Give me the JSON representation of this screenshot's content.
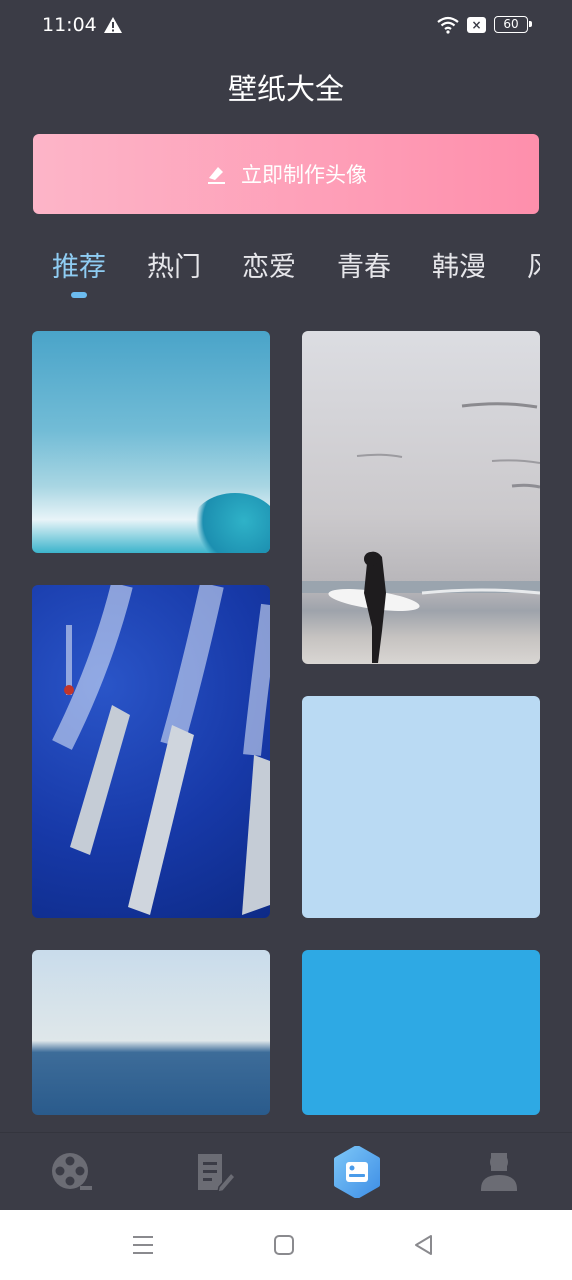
{
  "status_bar": {
    "time": "11:04",
    "battery": "60"
  },
  "header": {
    "title": "壁纸大全"
  },
  "cta": {
    "label": "立即制作头像",
    "icon": "edit-icon"
  },
  "tabs": [
    {
      "label": "推荐",
      "active": true
    },
    {
      "label": "热门",
      "active": false
    },
    {
      "label": "恋爱",
      "active": false
    },
    {
      "label": "青春",
      "active": false
    },
    {
      "label": "韩漫",
      "active": false
    },
    {
      "label": "风",
      "active": false
    }
  ],
  "wallpapers": [
    {
      "name": "ocean-wave"
    },
    {
      "name": "surfer-on-beach"
    },
    {
      "name": "navy-ships"
    },
    {
      "name": "light-blue-solid"
    },
    {
      "name": "sea-horizon"
    },
    {
      "name": "sky-blue-solid"
    }
  ],
  "bottom_nav": [
    {
      "icon": "film-reel-icon",
      "active": false
    },
    {
      "icon": "notes-icon",
      "active": false
    },
    {
      "icon": "wallpaper-icon",
      "active": true
    },
    {
      "icon": "profile-icon",
      "active": false
    }
  ],
  "colors": {
    "background": "#3b3c46",
    "accent": "#6cbcf0",
    "cta_start": "#fdb5c8",
    "cta_end": "#fe8fac"
  }
}
